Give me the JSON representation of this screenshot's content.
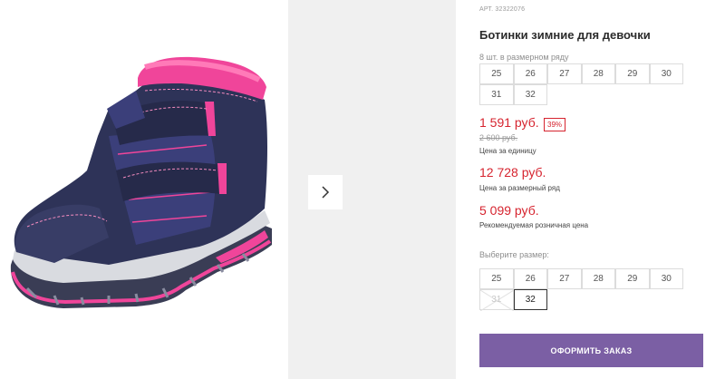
{
  "product": {
    "article": "АРТ. 32322076",
    "title": "Ботинки зимние для девочки",
    "image_alt": "boot-photo"
  },
  "pack": {
    "note": "8 шт. в размерном ряду",
    "sizes": [
      "25",
      "26",
      "27",
      "28",
      "29",
      "30",
      "31",
      "32"
    ]
  },
  "prices": {
    "unit_price": "1 591 руб.",
    "discount": "39%",
    "old_price": "2 600 руб.",
    "unit_caption": "Цена за единицу",
    "pack_price": "12 728 руб.",
    "pack_caption": "Цена за размерный ряд",
    "retail_price": "5 099 руб.",
    "retail_caption": "Рекомендуемая розничная цена"
  },
  "size_select": {
    "label": "Выберите размер:",
    "sizes": [
      "25",
      "26",
      "27",
      "28",
      "29",
      "30",
      "31",
      "32"
    ],
    "disabled": [
      "31"
    ],
    "selected": "32"
  },
  "order_button": {
    "label": "ОФОРМИТЬ ЗАКАЗ"
  },
  "colors": {
    "accent": "#7b5fa4",
    "price": "#d6242f",
    "boot_navy": "#2e3358",
    "boot_pink": "#f0459a"
  },
  "icons": {
    "gallery_next": "chevron-right-icon"
  }
}
